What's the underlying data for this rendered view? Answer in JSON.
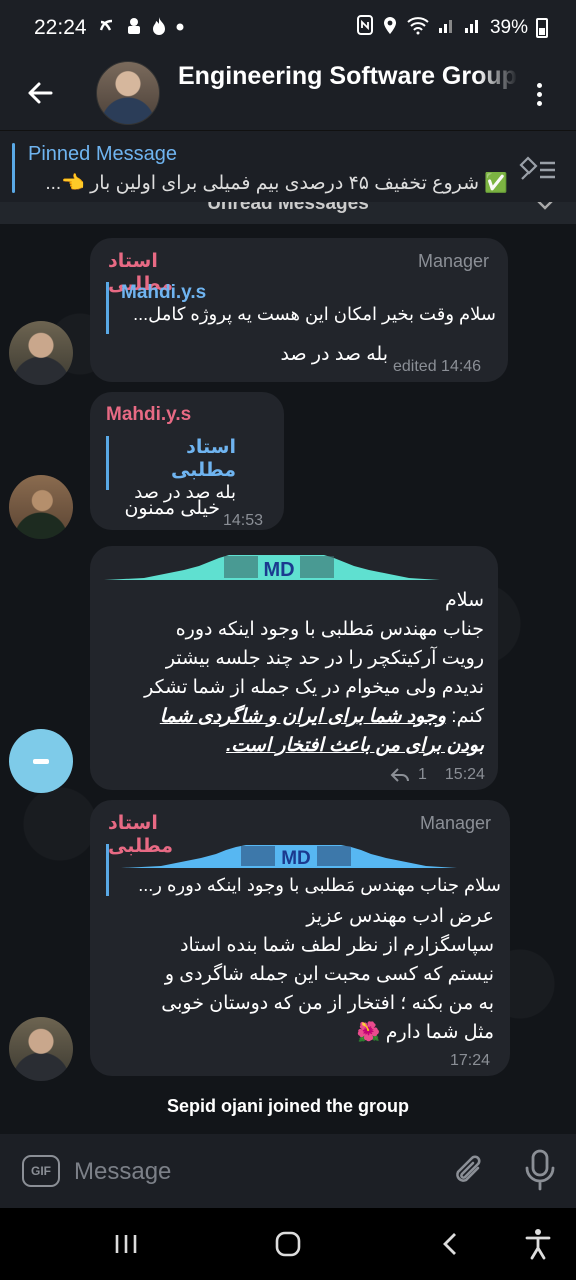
{
  "status_bar": {
    "time": "22:24",
    "battery": "39%",
    "icons": [
      "notification-icon",
      "android-icon",
      "fire-icon",
      "dot-icon",
      "nfc-icon",
      "location-icon",
      "wifi-icon",
      "signal-icon",
      "signal-icon",
      "battery-icon"
    ]
  },
  "header": {
    "title": "Engineering Software Group"
  },
  "pinned": {
    "title": "Pinned Message",
    "text": "✅ شروع تخفیف ۴۵ درصدی بیم فمیلی  برای اولین بار  👈..."
  },
  "unread_label": "Unread Messages",
  "messages": [
    {
      "sender": "استاد مطلبی",
      "role": "Manager",
      "reply_name": "Mahdi.y.s",
      "reply_text": "سلام وقت بخیر امکان این هست یه پروژه کامل...",
      "text": "بله صد در صد",
      "time": "edited 14:46"
    },
    {
      "sender": "Mahdi.y.s",
      "reply_name": "استاد مطلبی",
      "reply_text": "بله صد در صد",
      "text": "خیلی ممنون",
      "time": "14:53"
    },
    {
      "wave_label": "MD",
      "lines": [
        "سلام",
        "جناب مهندس مَطلبی با وجود اینکه دوره",
        "رویت آرکیتکچر را در حد چند جلسه بیشتر",
        "ندیدم ولی میخوام در یک جمله از شما تشکر"
      ],
      "line5_prefix": "کنم: ",
      "emphasis_1": "وجود شما برای ایران و شاگردی شما",
      "emphasis_2": "بودن برای من باعث افتخار است.",
      "reply_count": "1",
      "time": "15:24"
    },
    {
      "sender": "استاد مطلبی",
      "role": "Manager",
      "reply_wave_label": "MD",
      "reply_text": "سلام جناب مهندس مَطلبی با وجود اینکه دوره ر...",
      "lines": [
        "عرض ادب مهندس عزیز",
        "سپاسگزارم از نظر لطف شما بنده استاد",
        "نیستم که کسی محبت این جمله شاگردی و",
        "به من بکنه ؛ افتخار از من که دوستان خوبی",
        "مثل شما دارم 🌺"
      ],
      "time": "17:24"
    }
  ],
  "service_message": "Sepid ojani joined the group",
  "input": {
    "placeholder": "Message",
    "gif_label": "GIF"
  }
}
